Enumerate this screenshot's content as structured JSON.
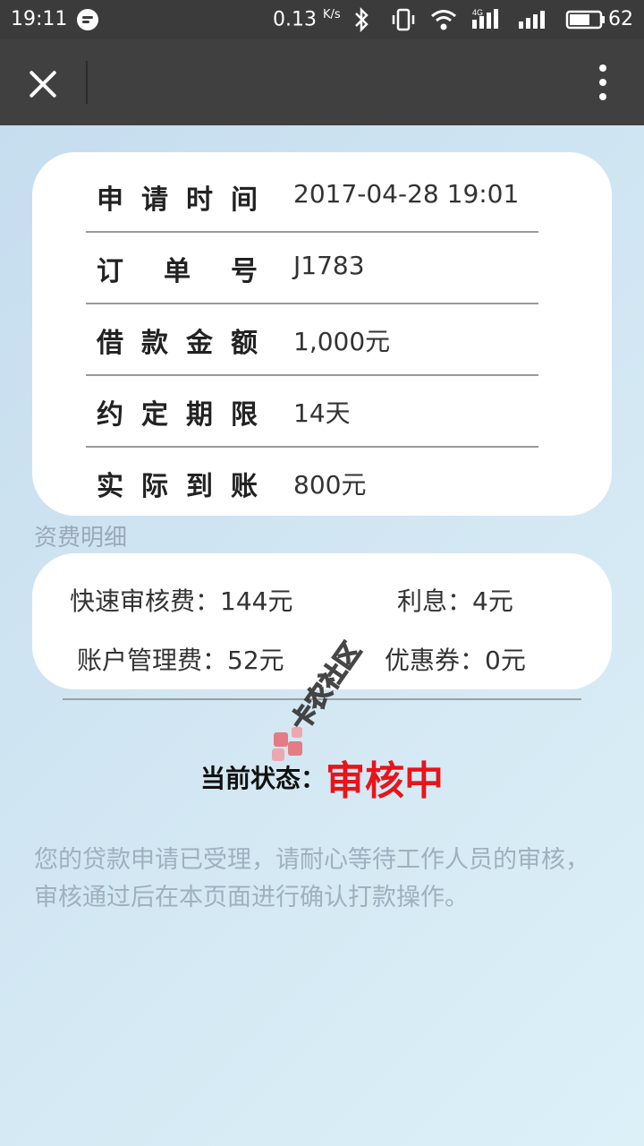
{
  "status_bar": {
    "time": "19:11",
    "speed": "0.13",
    "speed_unit": "K/s",
    "battery": "62",
    "signal": "4G"
  },
  "title_bar": {
    "icons": [
      "close-icon",
      "more-vert-icon"
    ]
  },
  "order": {
    "rows": [
      {
        "label": "申请时间",
        "value": "2017-04-28 19:01"
      },
      {
        "label": "订单号",
        "value": "J1783"
      },
      {
        "label": "借款金额",
        "value": "1,000元"
      },
      {
        "label": "约定期限",
        "value": "14天"
      },
      {
        "label": "实际到账",
        "value": "800元"
      }
    ]
  },
  "fees": {
    "title": "资费明细",
    "items": [
      {
        "label": "快速审核费：",
        "value": "144元"
      },
      {
        "label": "利息：",
        "value": "4元"
      },
      {
        "label": "账户管理费：",
        "value": "52元"
      },
      {
        "label": "优惠券：",
        "value": "0元"
      }
    ]
  },
  "status": {
    "label": "当前状态：",
    "value": "审核中",
    "color": "#e8141a"
  },
  "notice": "您的贷款申请已受理，请耐心等待工作人员的审核，审核通过后在本页面进行确认打款操作。",
  "watermark": "卡农社区"
}
